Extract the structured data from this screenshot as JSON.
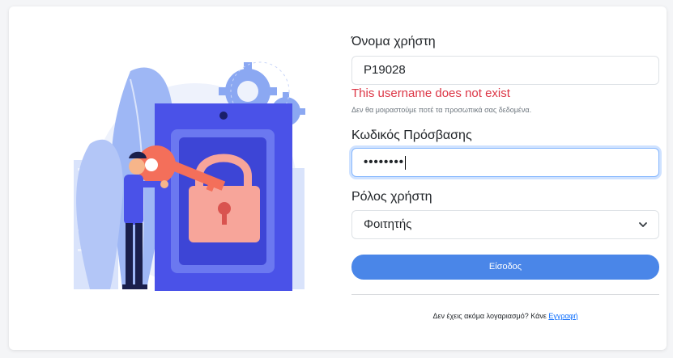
{
  "form": {
    "username_label": "Όνομα χρήστη",
    "username_value": "P19028",
    "username_error": "This username does not exist",
    "privacy_help": "Δεν θα μοιραστούμε ποτέ τα προσωπικά σας δεδομένα.",
    "password_label": "Κωδικός Πρόσβασης",
    "password_mask": "••••••••",
    "role_label": "Ρόλος χρήστη",
    "role_selected": "Φοιτητής",
    "login_button": "Είσοδος",
    "signup_prompt": "Δεν έχεις ακόμα λογαριασμό? Κάνε ",
    "signup_link": "Εγγραφή"
  },
  "illustration": {
    "icon": "person-holding-key-lock-icon",
    "colors": {
      "blob": "#9eb7f5",
      "door": "#4a52e8",
      "lock": "#f7a59a",
      "key": "#f46f5a",
      "gear": "#8ba8f2"
    }
  },
  "colors": {
    "error": "#dc3545",
    "primary_button": "#4a86e8",
    "link": "#0d6efd"
  }
}
